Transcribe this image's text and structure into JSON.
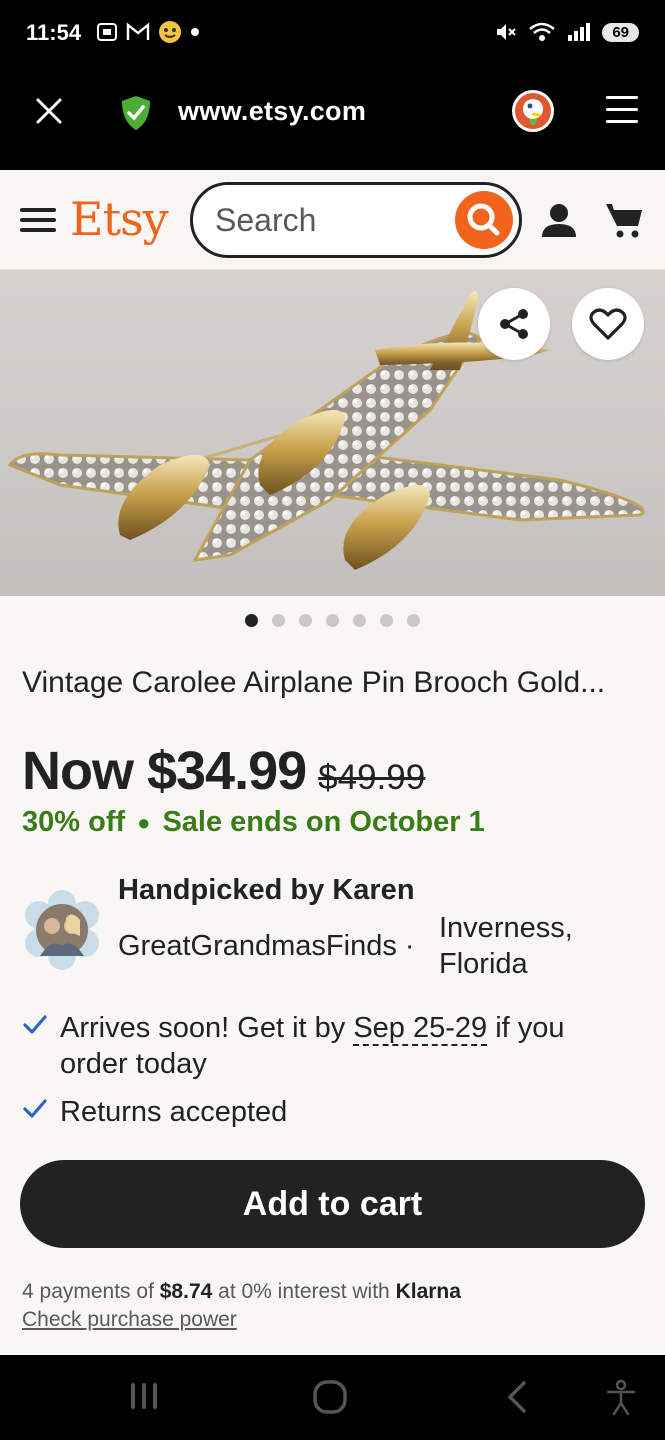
{
  "status_bar": {
    "time": "11:54",
    "battery": "69",
    "left_icons": [
      "screenshot-icon",
      "gmail-icon",
      "emoji-app-icon",
      "notification-dot"
    ],
    "right_icons": [
      "mute-icon",
      "wifi-icon",
      "signal-icon"
    ]
  },
  "browser": {
    "url": "www.etsy.com",
    "close_icon": "close-icon",
    "shield_icon": "shield-check-icon",
    "duckduckgo_icon": "duckduckgo-icon",
    "menu_icon": "menu-icon"
  },
  "etsy_header": {
    "logo": "Etsy",
    "search_placeholder": "Search",
    "accent_color": "#f1641e"
  },
  "listing": {
    "image_count": 7,
    "active_image": 0,
    "title": "Vintage Carolee Airplane Pin Brooch Gold...",
    "price_now": "Now $34.99",
    "price_original": "$49.99",
    "discount": "30% off",
    "sale_ends": "Sale ends on October 1",
    "sale_color": "#3a7d18"
  },
  "seller": {
    "handpicked": "Handpicked by Karen",
    "shop_name": "GreatGrandmasFinds",
    "separator": "·",
    "location_line1": "Inverness,",
    "location_line2": "Florida"
  },
  "perks": {
    "arrives_prefix": "Arrives soon! Get it by ",
    "arrives_date": "Sep 25-29",
    "arrives_suffix": " if you",
    "arrives_line2": "order today",
    "returns": "Returns accepted"
  },
  "cart": {
    "add_to_cart": "Add to cart"
  },
  "klarna": {
    "prefix": "4 payments of ",
    "amount": "$8.74",
    "middle": " at 0% interest with ",
    "provider": "Klarna",
    "link": "Check purchase power"
  },
  "nav_bar": {
    "icons": [
      "recent-apps-icon",
      "home-icon",
      "back-icon",
      "accessibility-icon"
    ]
  }
}
